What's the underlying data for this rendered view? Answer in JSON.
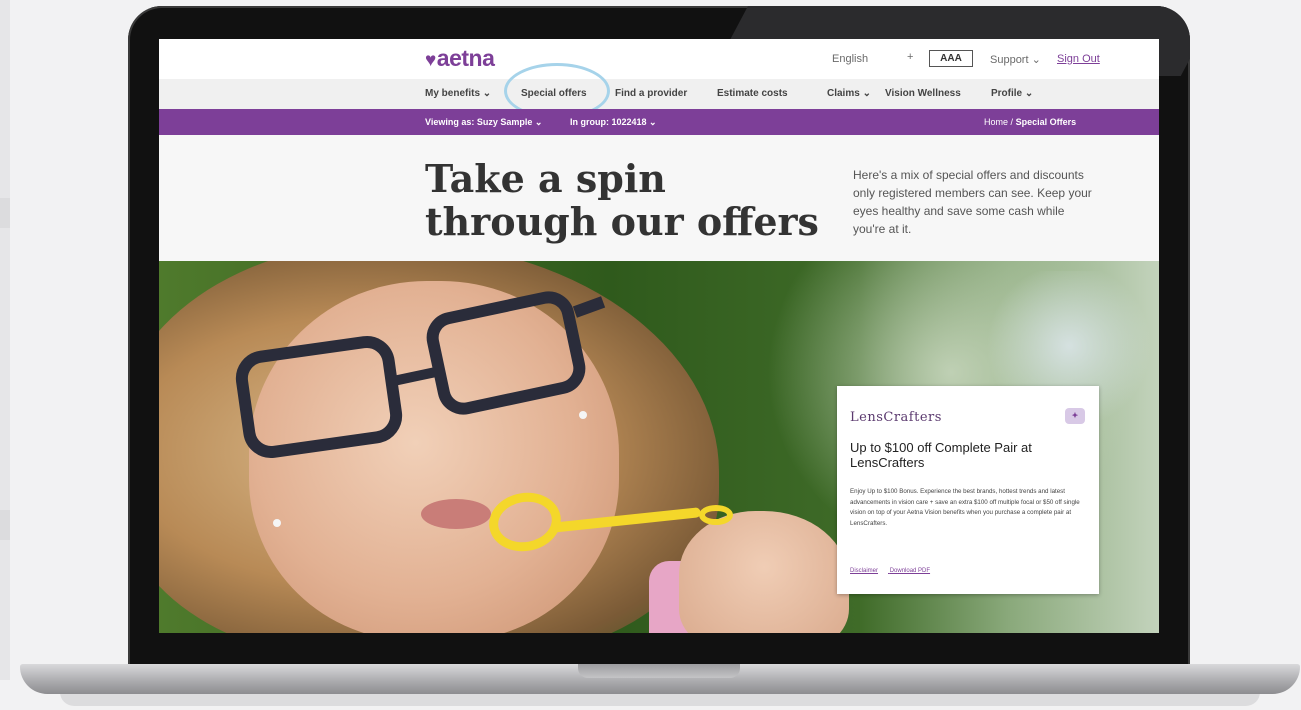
{
  "header": {
    "logo": "aetna",
    "language": "English",
    "language_caret": "+",
    "text_size": "AAA",
    "support": "Support",
    "sign_out": "Sign Out"
  },
  "nav": {
    "items": [
      "My benefits",
      "Special offers",
      "Find a provider",
      "Estimate costs",
      "Claims",
      "Vision Wellness",
      "Profile"
    ]
  },
  "member_bar": {
    "viewing_as": "Viewing as: Suzy Sample",
    "group": "In group: 1022418",
    "breadcrumb_home": "Home",
    "breadcrumb_sep": "/",
    "breadcrumb_current": "Special Offers"
  },
  "hero": {
    "title": "Take a spin through our offers",
    "description": "Here's a mix of special offers and discounts only registered members can see. Keep your eyes healthy and save some cash while you're at it."
  },
  "offer_card": {
    "brand": "LensCrafters",
    "title": "Up to $100 off Complete Pair at LensCrafters",
    "body": "Enjoy Up to $100 Bonus. Experience the best brands, hottest trends and latest advancements in vision care + save an extra $100 off multiple focal or $50 off single vision on top of your Aetna Vision benefits when you purchase a complete pair at LensCrafters.",
    "link_disclaimer": "Disclaimer",
    "link_pdf": "Download PDF"
  },
  "colors": {
    "brand_purple": "#7d3f98",
    "highlight_ring": "#a6d3ea"
  },
  "icons": {
    "logo": "heart-icon",
    "caret": "chevron-down-icon",
    "badge": "offer-badge-icon"
  }
}
